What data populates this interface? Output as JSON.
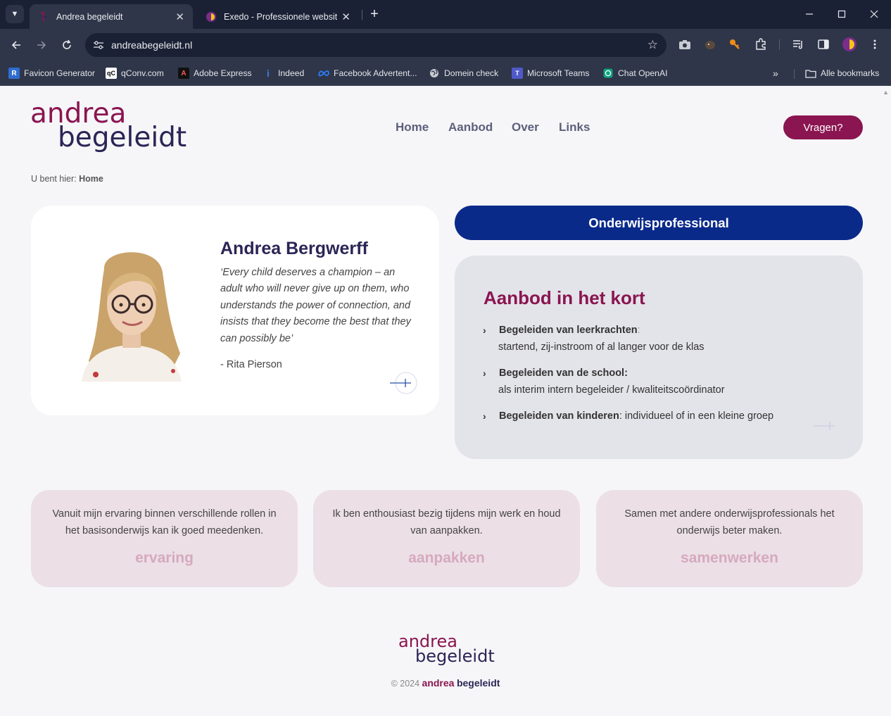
{
  "browser": {
    "tabs": [
      {
        "title": "Andrea begeleidt",
        "active": true
      },
      {
        "title": "Exedo - Professionele websites",
        "active": false
      }
    ],
    "url": "andreabegeleidt.nl",
    "bookmarks": [
      {
        "label": "Favicon Generator",
        "icon": "R"
      },
      {
        "label": "qConv.com",
        "icon": "qC"
      },
      {
        "label": "Adobe Express",
        "icon": "A"
      },
      {
        "label": "Indeed",
        "icon": "i"
      },
      {
        "label": "Facebook Advertent...",
        "icon": "meta-icon"
      },
      {
        "label": "Domein check",
        "icon": "globe-icon"
      },
      {
        "label": "Microsoft Teams",
        "icon": "T"
      },
      {
        "label": "Chat OpenAI",
        "icon": "openai-icon"
      }
    ],
    "all_bookmarks": "Alle bookmarks"
  },
  "site": {
    "logo": {
      "line1": "andrea",
      "line2": "begeleidt"
    },
    "nav": [
      "Home",
      "Aanbod",
      "Over",
      "Links"
    ],
    "cta": "Vragen?",
    "breadcrumb": {
      "prefix": "U bent hier:",
      "current": "Home"
    },
    "profile": {
      "name": "Andrea Bergwerff",
      "quote": "‘Every child deserves a champion – an adult who will never give up on them, who understands the power of connection, and insists that they become the best that they can possibly be’",
      "author": "- Rita Pierson"
    },
    "profession": "Onderwijsprofessional",
    "offer": {
      "title": "Aanbod in het kort",
      "items": [
        {
          "bold": "Begeleiden van leerkrachten",
          "rest": ":",
          "line2": "startend, zij-instroom of al langer voor de klas"
        },
        {
          "bold": "Begeleiden van de school:",
          "rest": "",
          "line2": "als interim intern begeleider / kwaliteitscoördinator"
        },
        {
          "bold": "Begeleiden van kinderen",
          "rest": ": individueel of in een kleine groep",
          "line2": ""
        }
      ]
    },
    "values": [
      {
        "text": "Vanuit mijn ervaring binnen verschillende rollen in het basisonderwijs kan ik goed meedenken.",
        "word": "ervaring"
      },
      {
        "text": "Ik ben enthousiast bezig tijdens mijn werk en houd van aanpakken.",
        "word": "aanpakken"
      },
      {
        "text": "Samen met andere onderwijsprofessionals het onderwijs beter maken.",
        "word": "samenwerken"
      }
    ],
    "footer": {
      "copy": "© 2024",
      "brand1": "andrea",
      "brand2": "begeleidt"
    }
  },
  "colors": {
    "brand_magenta": "#8a1550",
    "brand_navy": "#2b2556",
    "profession_blue": "#0a2a8a"
  }
}
